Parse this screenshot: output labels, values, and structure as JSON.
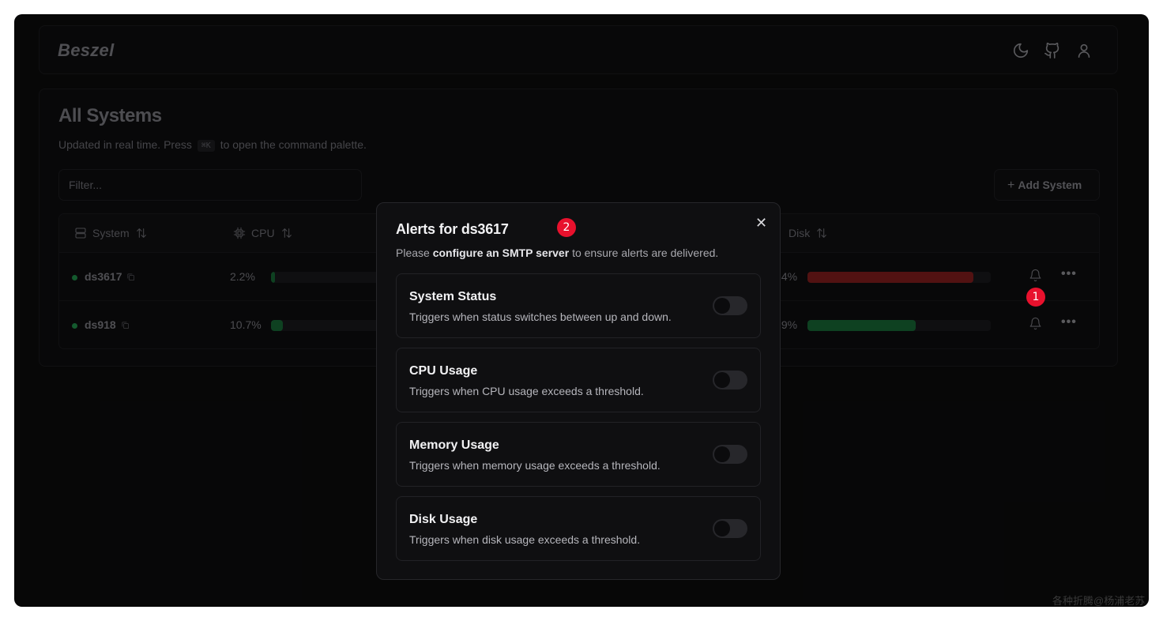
{
  "header": {
    "logo": "Beszel",
    "icons": [
      "theme-toggle-icon",
      "github-icon",
      "user-icon"
    ]
  },
  "page": {
    "title": "All Systems",
    "subtitle_before": "Updated in real time. Press",
    "shortcut": "⌘K",
    "subtitle_after": "to open the command palette.",
    "filter_placeholder": "Filter...",
    "add_button": "Add System"
  },
  "table": {
    "columns": {
      "system": "System",
      "cpu": "CPU",
      "disk": "Disk"
    },
    "rows": [
      {
        "name": "ds3617",
        "cpu": "2.2%",
        "cpu_fraction": 0.022,
        "disk": ".4%",
        "disk_fraction": 0.905,
        "disk_color": "#7f1d1d"
      },
      {
        "name": "ds918",
        "cpu": "10.7%",
        "cpu_fraction": 0.107,
        "disk": ".9%",
        "disk_fraction": 0.589,
        "disk_color": "#166534"
      }
    ]
  },
  "dialog": {
    "title": "Alerts for ds3617",
    "desc_before": "Please",
    "desc_link": "configure an SMTP server",
    "desc_after": "to ensure alerts are delivered.",
    "alerts": [
      {
        "title": "System Status",
        "desc": "Triggers when status switches between up and down.",
        "enabled": false
      },
      {
        "title": "CPU Usage",
        "desc": "Triggers when CPU usage exceeds a threshold.",
        "enabled": false
      },
      {
        "title": "Memory Usage",
        "desc": "Triggers when memory usage exceeds a threshold.",
        "enabled": false
      },
      {
        "title": "Disk Usage",
        "desc": "Triggers when disk usage exceeds a threshold.",
        "enabled": false
      }
    ]
  },
  "annotations": {
    "badge_1": "1",
    "badge_2": "2"
  },
  "watermark": "各种折腾@杨浦老苏",
  "colors": {
    "status_up": "#1f8a47",
    "cpu_bar": "#166534",
    "badge": "#e8112d"
  }
}
